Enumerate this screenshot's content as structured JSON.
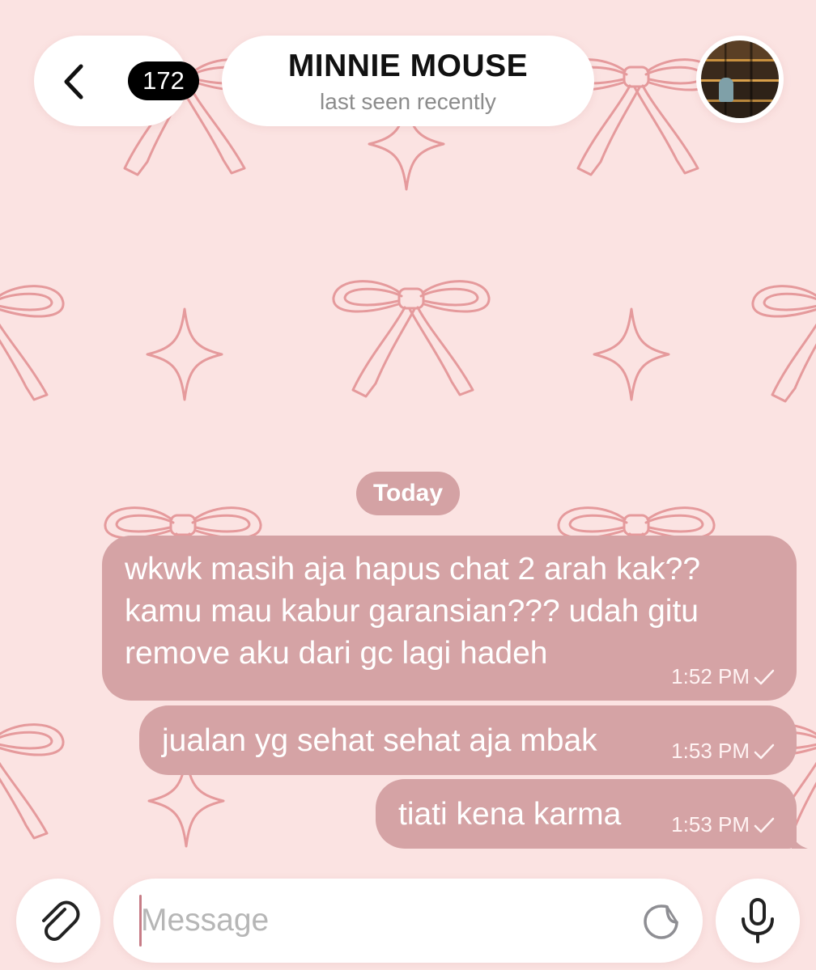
{
  "header": {
    "back_icon": "chevron-left-icon",
    "unread_count": "172",
    "chat_name": "MINNIE MOUSE",
    "status": "last seen recently",
    "avatar": "avatar-photo"
  },
  "date_separator": "Today",
  "messages": [
    {
      "text": "wkwk masih aja hapus chat 2 arah kak?? kamu mau kabur garansian??? udah gitu remove aku dari gc lagi hadeh",
      "time": "1:52 PM",
      "status": "sent"
    },
    {
      "text": "jualan yg sehat sehat aja mbak",
      "time": "1:53 PM",
      "status": "sent"
    },
    {
      "text": "tiati kena karma",
      "time": "1:53 PM",
      "status": "sent"
    }
  ],
  "composer": {
    "placeholder": "Message",
    "attach_icon": "paperclip-icon",
    "sticker_icon": "sticker-icon",
    "mic_icon": "microphone-icon"
  },
  "colors": {
    "wallpaper": "#fbe3e2",
    "pattern": "#e59a9c",
    "bubble": "#d5a3a5",
    "date_chip": "#d4a2a4"
  }
}
